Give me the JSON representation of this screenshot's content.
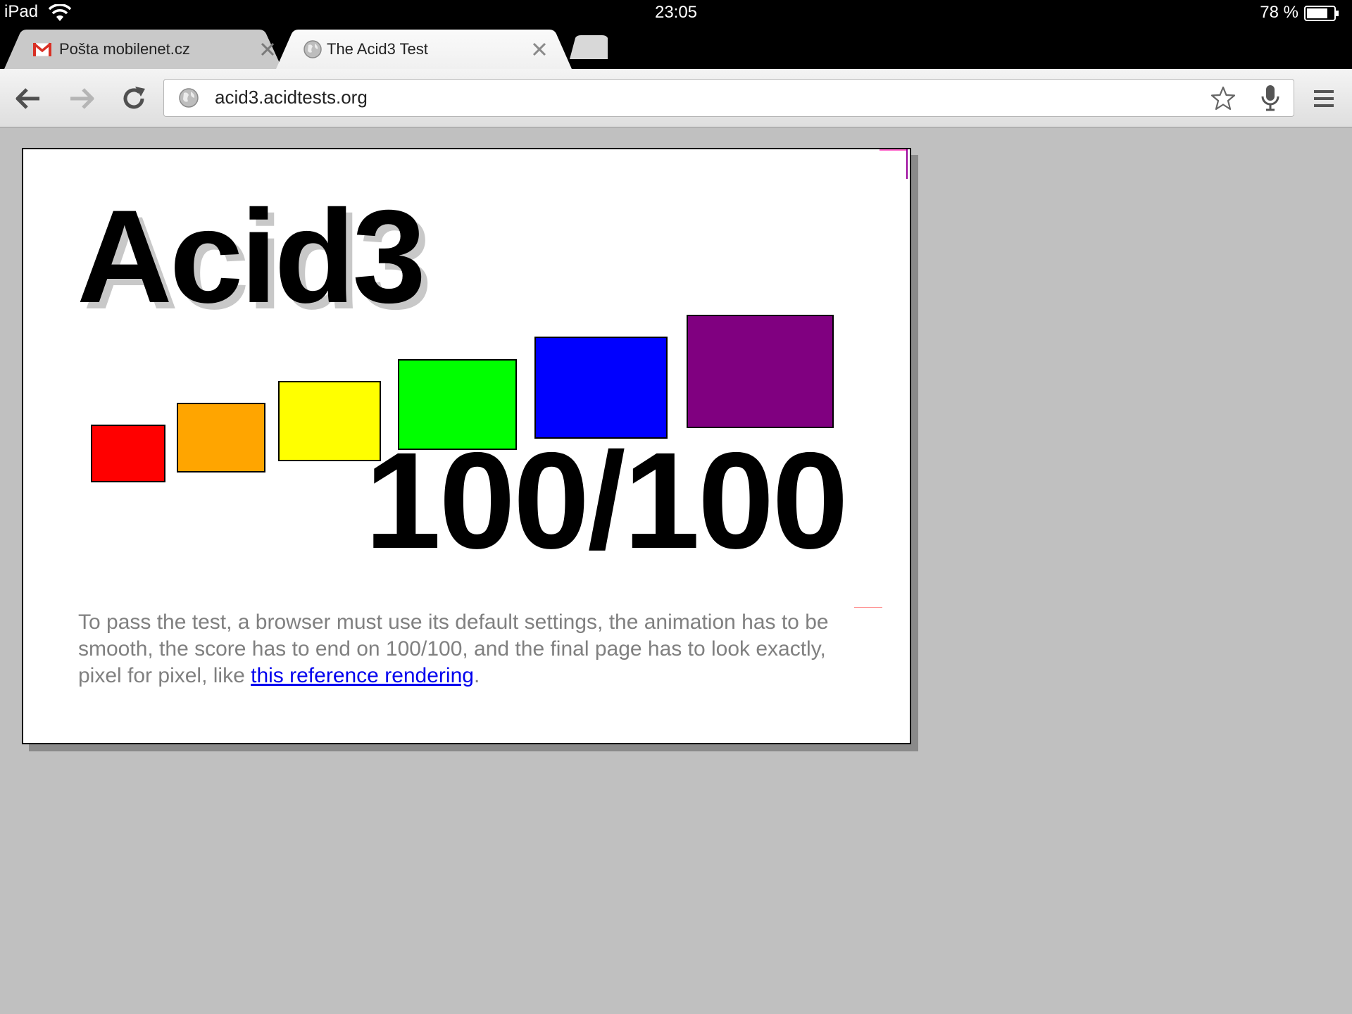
{
  "status_bar": {
    "device": "iPad",
    "time": "23:05",
    "battery": "78 %",
    "battery_level": 0.78
  },
  "tabs": [
    {
      "title": "Pošta mobilenet.cz",
      "favicon": "gmail-icon",
      "active": false
    },
    {
      "title": "The Acid3 Test",
      "favicon": "globe-icon",
      "active": true
    }
  ],
  "toolbar": {
    "url": "acid3.acidtests.org"
  },
  "page": {
    "title": "Acid3",
    "score": "100/100",
    "instructions": "To pass the test, a browser must use its default settings, the animation has to be smooth, the score has to end on 100/100, and the final page has to look exactly, pixel for pixel, like ",
    "link_text": "this reference rendering",
    "trailing": ".",
    "bucket_colors": [
      "#ff0000",
      "#ffa500",
      "#ffff00",
      "#00ff00",
      "#0000ff",
      "#800080"
    ]
  }
}
